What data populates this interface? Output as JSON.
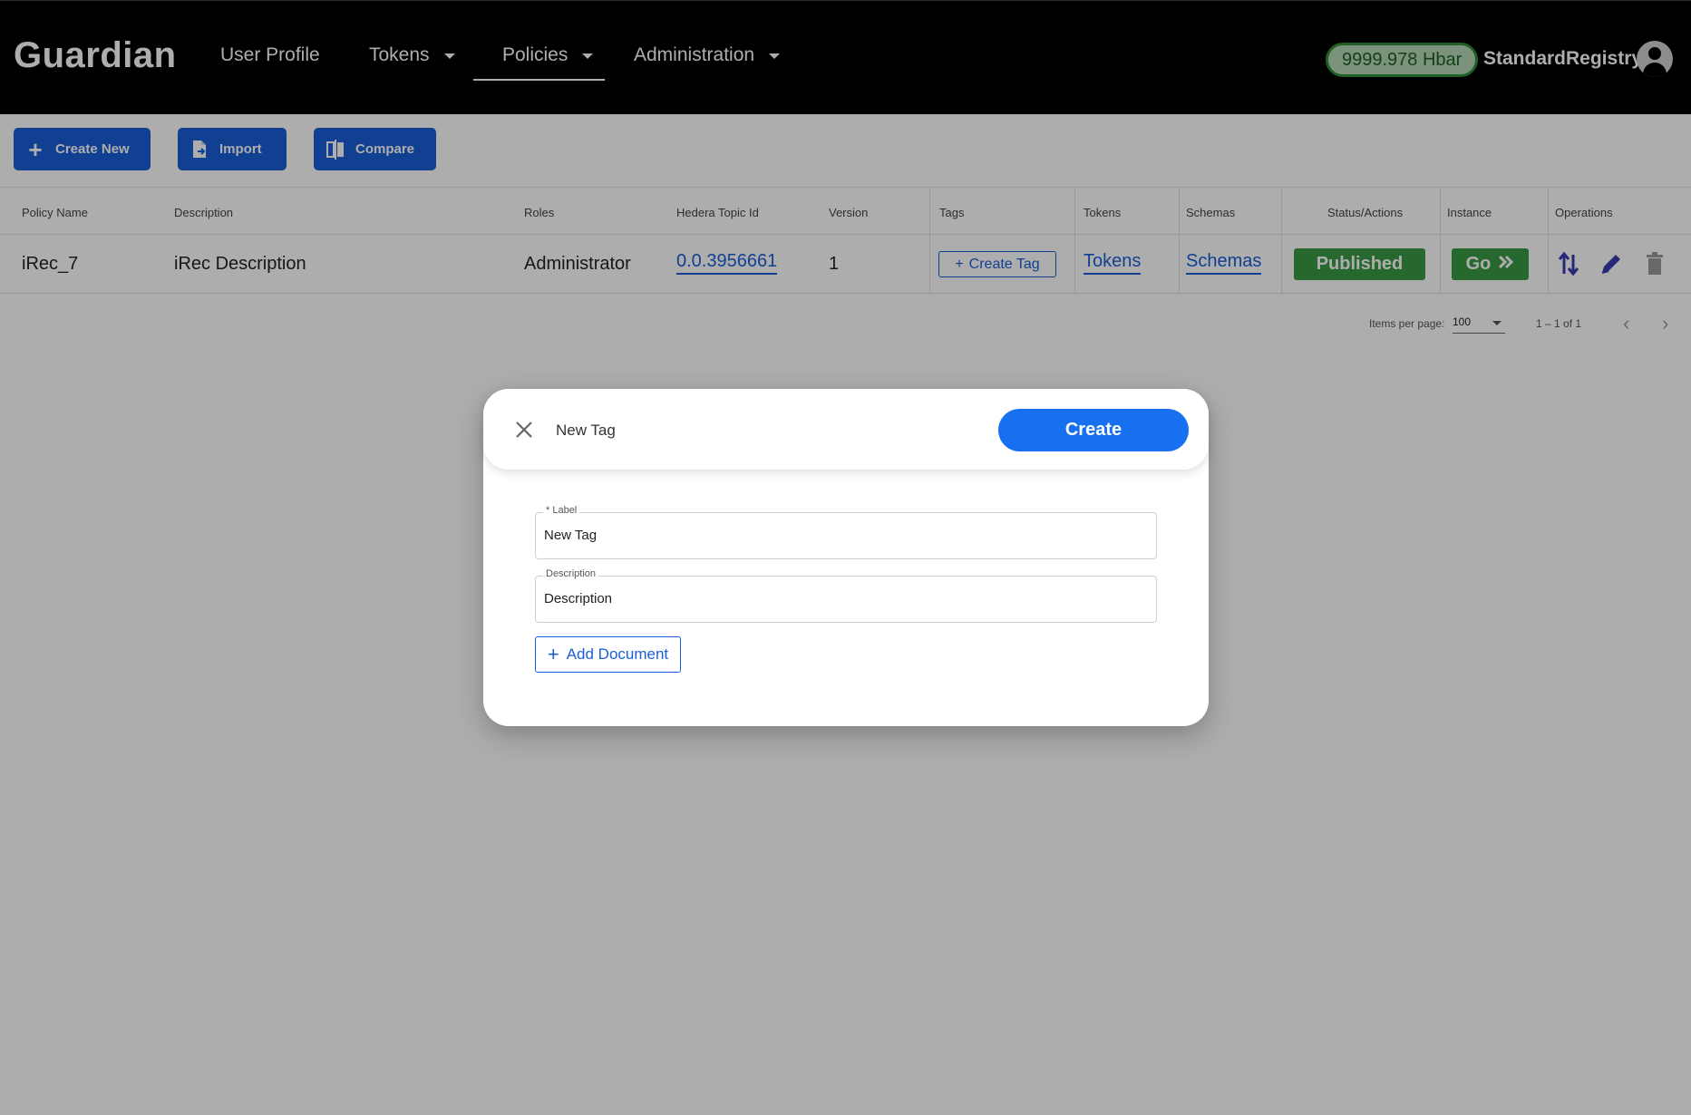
{
  "header": {
    "logo": "Guardian",
    "nav": [
      {
        "label": "User Profile"
      },
      {
        "label": "Tokens"
      },
      {
        "label": "Policies"
      },
      {
        "label": "Administration"
      }
    ],
    "balance": "9999.978 Hbar",
    "username": "StandardRegistry"
  },
  "toolbar": {
    "create_label": "Create New",
    "import_label": "Import",
    "compare_label": "Compare"
  },
  "table": {
    "columns": [
      "Policy Name",
      "Description",
      "Roles",
      "Hedera Topic Id",
      "Version",
      "Tags",
      "Tokens",
      "Schemas",
      "Status/Actions",
      "Instance",
      "Operations"
    ],
    "rows": [
      {
        "name": "iRec_7",
        "description": "iRec Description",
        "roles": "Administrator",
        "topic_id": "0.0.3956661",
        "version": "1",
        "tag_button": "Create Tag",
        "tokens": "Tokens",
        "schemas": "Schemas",
        "status": "Published",
        "instance": "Go"
      }
    ]
  },
  "paginator": {
    "items_per_page_label": "Items per page:",
    "items_per_page": "100",
    "range": "1 – 1 of 1"
  },
  "dialog": {
    "title": "New Tag",
    "create_label": "Create",
    "label_field": {
      "label": "* Label",
      "value": "New Tag"
    },
    "description_field": {
      "label": "Description",
      "value": "Description"
    },
    "add_document_label": "Add Document"
  },
  "colors": {
    "primary": "#1a5fd8",
    "success": "#3a9a44",
    "header_bg": "#000000",
    "dialog_button": "#1670f0"
  }
}
